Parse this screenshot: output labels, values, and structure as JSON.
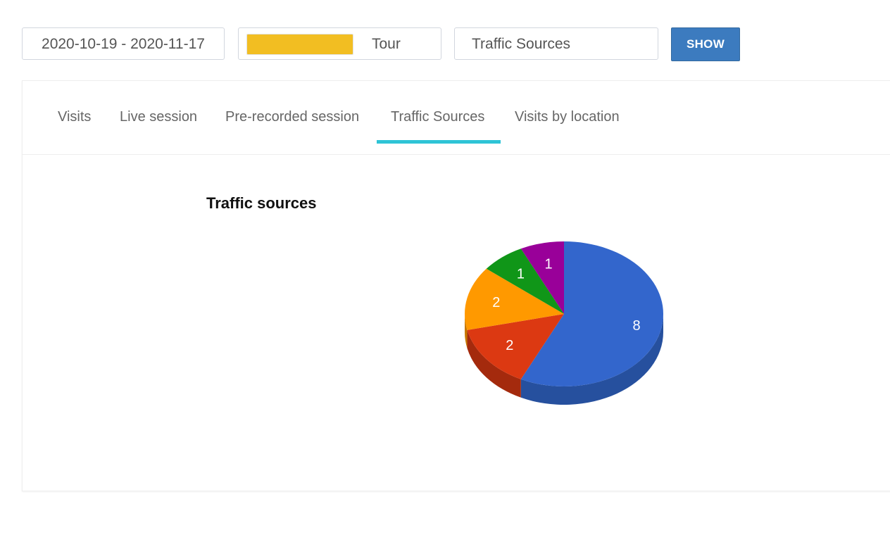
{
  "filters": {
    "date_range": "2020-10-19 - 2020-11-17",
    "tour_label": "Tour",
    "tour_swatch_color": "#f2be22",
    "report_type": "Traffic Sources",
    "show_button": "SHOW"
  },
  "tabs": [
    {
      "label": "Visits"
    },
    {
      "label": "Live session"
    },
    {
      "label": "Pre-recorded session"
    },
    {
      "label": "Traffic Sources",
      "active": true
    },
    {
      "label": "Visits by location"
    }
  ],
  "chart_data": {
    "type": "pie",
    "style": "3d",
    "title": "Traffic sources",
    "slices": [
      {
        "value": 8,
        "color": "#3366cc",
        "side_color": "#26509e"
      },
      {
        "value": 2,
        "color": "#dc3912",
        "side_color": "#a42a0d"
      },
      {
        "value": 2,
        "color": "#ff9900",
        "side_color": "#c77700"
      },
      {
        "value": 1,
        "color": "#109618",
        "side_color": "#0b6e12"
      },
      {
        "value": 1,
        "color": "#990099",
        "side_color": "#700070"
      }
    ]
  }
}
